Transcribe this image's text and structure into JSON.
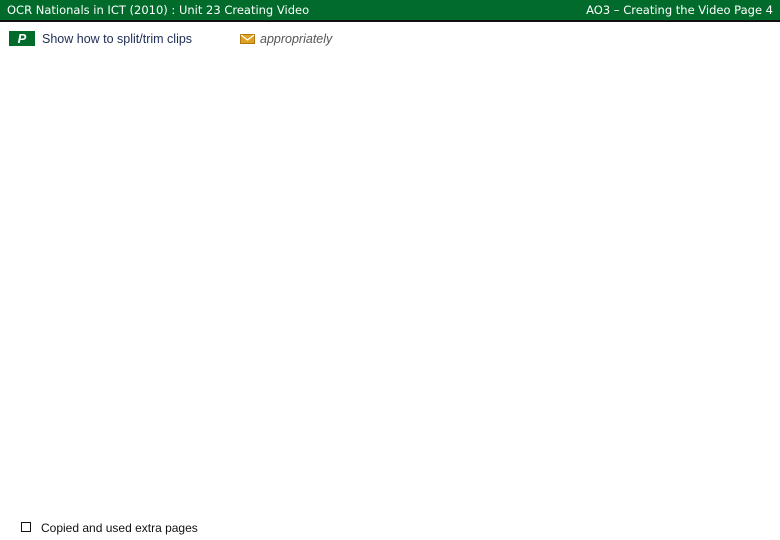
{
  "header": {
    "left_title": "OCR Nationals in ICT (2010) : Unit 23 Creating Video",
    "right_title": "AO3 – Creating the Video Page 4"
  },
  "criteria": {
    "badge_letter": "P",
    "text": "Show how to split/trim clips",
    "note_icon": "envelope-icon",
    "note_text": "appropriately"
  },
  "footer": {
    "checkbox_label": "Copied and used extra pages",
    "checkbox_checked": false
  },
  "colors": {
    "header_bg": "#006b2b",
    "badge_bg": "#006b2b",
    "note_icon": "#e0a020",
    "criteria_text": "#1c2c55"
  }
}
